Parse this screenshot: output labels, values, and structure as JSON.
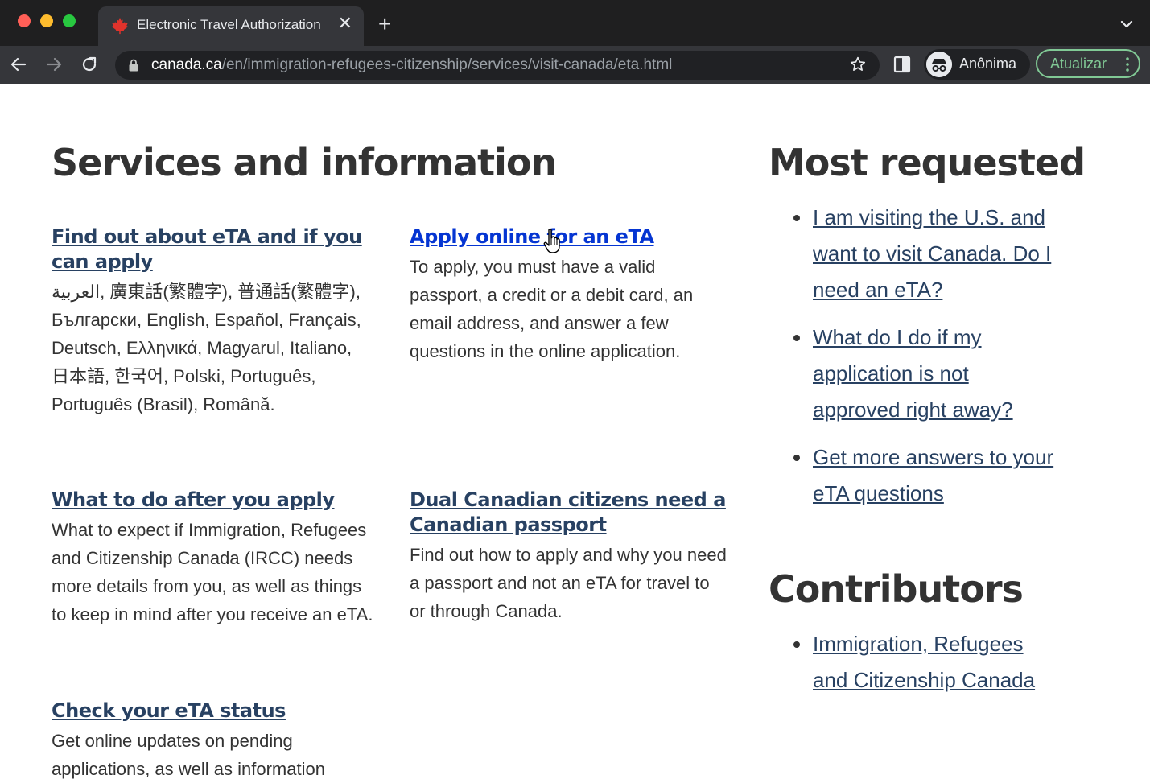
{
  "browser": {
    "tab_title": "Electronic Travel Authorization",
    "tab_close": "✕",
    "new_tab": "+",
    "url_host": "canada.ca",
    "url_path": "/en/immigration-refugees-citizenship/services/visit-canada/eta.html",
    "profile_label": "Anônima",
    "update_label": "Atualizar",
    "colors": {
      "close": "#ff5f57",
      "minimize": "#febc2e",
      "maximize": "#28c840",
      "update_accent": "#81c995"
    }
  },
  "services": {
    "heading": "Services and information",
    "cards": [
      {
        "link": "Find out about eTA and if you can apply",
        "text": "العربية, 廣東話(繁體字), 普通話(繁體字), Български, English, Español, Français, Deutsch, Ελληνικά, Magyarul, Italiano, 日本語, 한국어, Polski, Português, Português (Brasil), Română."
      },
      {
        "link": "Apply online for an eTA",
        "text": "To apply, you must have a valid passport, a credit or a debit card, an email address, and answer a few questions in the online application."
      },
      {
        "link": "What to do after you apply",
        "text": "What to expect if Immigration, Refugees and Citizenship Canada (IRCC) needs more details from you, as well as things to keep in mind after you receive an eTA."
      },
      {
        "link": "Dual Canadian citizens need a Canadian passport",
        "text": "Find out how to apply and why you need a passport and not an eTA for travel to or through Canada."
      },
      {
        "link": "Check your eTA status",
        "text": "Get online updates on pending applications, as well as information"
      }
    ]
  },
  "most_requested": {
    "heading": "Most requested",
    "items": [
      "I am visiting the U.S. and want to visit Canada. Do I need an eTA?",
      "What do I do if my application is not approved right away?",
      "Get more answers to your eTA questions"
    ]
  },
  "contributors": {
    "heading": "Contributors",
    "items": [
      "Immigration, Refugees and Citizenship Canada"
    ]
  },
  "colors": {
    "link": "#284162",
    "link_active": "#0535d2",
    "text": "#333333"
  }
}
